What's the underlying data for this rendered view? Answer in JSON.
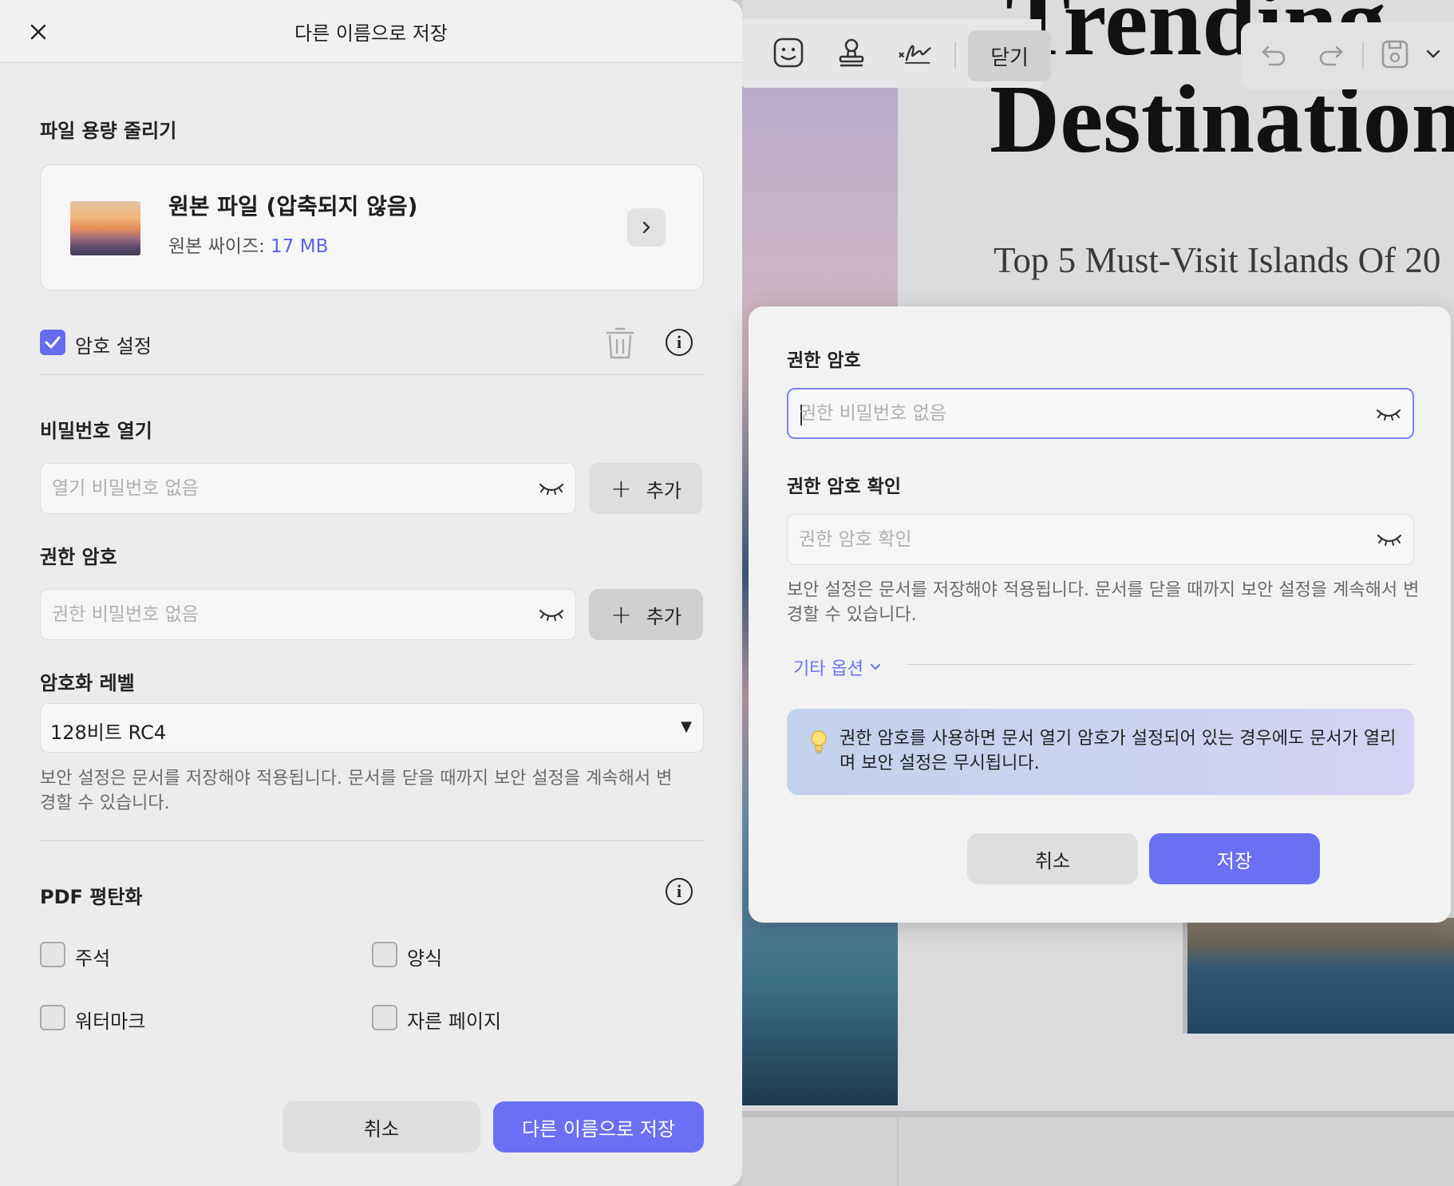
{
  "document": {
    "title_top": "Trending",
    "title": "Destinations",
    "subtitle": "Top 5 Must-Visit Islands Of 20"
  },
  "toolbar": {
    "close_label": "닫기",
    "icons": [
      "sticker-icon",
      "stamp-icon",
      "signature-icon",
      "undo-icon",
      "redo-icon",
      "save-icon",
      "chevron-down-icon"
    ]
  },
  "left_dialog": {
    "title": "다른 이름으로 저장",
    "compress": {
      "section_label": "파일 용량 줄리기",
      "file_name": "원본 파일 (압축되지 않음)",
      "size_label": "원본 싸이즈: ",
      "size_value": "17 MB"
    },
    "password": {
      "enabled": true,
      "label": "암호 설정",
      "open_password": {
        "label": "비밀번호 열기",
        "placeholder": "열기 비밀번호 없음",
        "add_label": "추가"
      },
      "permission_password": {
        "label": "권한 암호",
        "placeholder": "권한 비밀번호 없음",
        "add_label": "추가"
      },
      "encryption": {
        "label": "암호화 레벨",
        "value": "128비트 RC4"
      },
      "help": "보안 설정은 문서를 저장해야 적용됩니다. 문서를 닫을 때까지 보안 설정을 계속해서 변경할 수 있습니다."
    },
    "flatten": {
      "label": "PDF 평탄화",
      "options": [
        {
          "label": "주석",
          "checked": false
        },
        {
          "label": "양식",
          "checked": false
        },
        {
          "label": "워터마크",
          "checked": false
        },
        {
          "label": "자른 페이지",
          "checked": false
        }
      ]
    },
    "cancel_label": "취소",
    "save_as_label": "다른 이름으로 저장"
  },
  "permission_modal": {
    "password_label": "권한 암호",
    "password_placeholder": "권한 비밀번호 없음",
    "confirm_label": "권한 암호 확인",
    "confirm_placeholder": "권한 암호 확인",
    "help": "보안 설정은 문서를 저장해야 적용됩니다. 문서를 닫을 때까지 보안 설정을 계속해서 변경할 수 있습니다.",
    "more_options_label": "기타 옵션",
    "tip": "권한 암호를 사용하면 문서 열기 암호가 설정되어 있는 경우에도 문서가 열리며 보안 설정은 무시됩니다.",
    "cancel_label": "취소",
    "save_label": "저장"
  },
  "colors": {
    "accent": "#6a70f3",
    "size_value": "#5b63e8"
  }
}
